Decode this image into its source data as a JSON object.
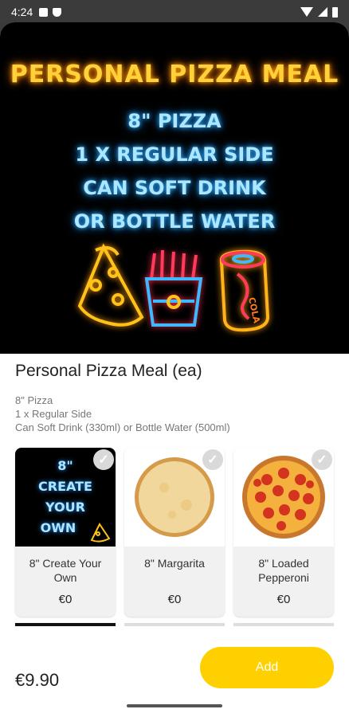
{
  "status_bar": {
    "time": "4:24",
    "icons": [
      "a-icon",
      "shield-icon",
      "wifi-icon",
      "signal-icon",
      "battery-icon"
    ]
  },
  "banner": {
    "title": "PERSONAL PIZZA MEAL",
    "lines": [
      "8\" PIZZA",
      "1 X REGULAR SIDE",
      "CAN SOFT DRINK",
      "OR BOTTLE WATER"
    ],
    "colors": {
      "title": "#ffd13a",
      "lines": "#aee6ff"
    },
    "art_icons": [
      "pizza-slice-icon",
      "fries-icon",
      "cola-can-icon"
    ],
    "can_label": "COLA"
  },
  "product": {
    "name": "Personal Pizza Meal (ea)",
    "description": [
      "8\" Pizza",
      "1 x Regular Side",
      "Can Soft Drink (330ml) or Bottle Water (500ml)"
    ]
  },
  "options": [
    {
      "name": "8\" Create Your Own",
      "price": "€0",
      "image": "create-your-own-image",
      "image_text": [
        "8\"",
        "CREATE",
        "YOUR",
        "OWN"
      ]
    },
    {
      "name": "8\" Margarita",
      "price": "€0",
      "image": "margarita-pizza-image"
    },
    {
      "name": "8\" Loaded Pepperoni",
      "price": "€0",
      "image": "pepperoni-pizza-image"
    }
  ],
  "footer": {
    "price": "€9.90",
    "add_label": "Add",
    "accent": "#ffd000"
  }
}
